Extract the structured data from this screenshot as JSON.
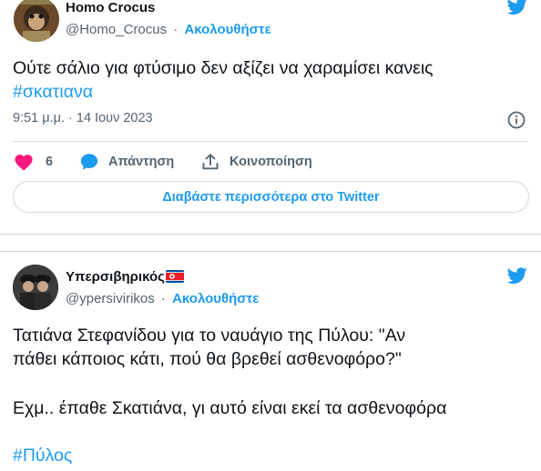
{
  "tweet1": {
    "name": "Homo Crocus",
    "handle": "@Homo_Crocus",
    "separator": "·",
    "follow_label": "Ακολουθήστε",
    "text": "Ούτε σάλιο για φτύσιμο δεν αξίζει να χαραμίσει κανεις",
    "hashtag": "#σκατιανα",
    "timestamp": "9:51 μ.μ. · 14 Ιουν 2023",
    "likes": "6",
    "reply_label": "Απάντηση",
    "share_label": "Κοινοποίηση",
    "read_more_label": "Διαβάστε περισσότερα στο Twitter"
  },
  "tweet2": {
    "name": "Υπερσιβηρικός",
    "handle": "@ypersivirikos",
    "separator": "·",
    "follow_label": "Ακολουθήστε",
    "text_line1": "Τατιάνα Στεφανίδου για το ναυάγιο της Πύλου: \"Αν",
    "text_line2": "πάθει κάποιος κάτι, πού θα βρεθεί ασθενοφόρο?\"",
    "text_line3": "Εχμ.. έπαθε Σκατιάνα, γι αυτό είναι εκεί τα ασθενοφόρα",
    "hashtag": "#Πύλος"
  },
  "colors": {
    "accent": "#1d9bf0",
    "like": "#f91880",
    "muted": "#536471",
    "border": "#cfd9de"
  },
  "icons": {
    "brand": "twitter-bird-icon",
    "info": "info-icon",
    "like": "heart-icon",
    "reply": "speech-bubble-icon",
    "share": "share-upload-icon",
    "flag": "north-korea-flag-icon"
  }
}
